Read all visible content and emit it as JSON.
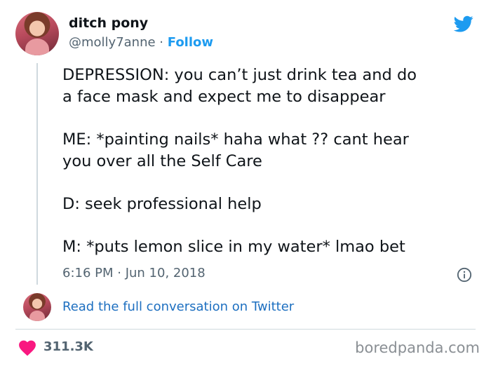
{
  "tweet": {
    "display_name": "ditch pony",
    "handle": "@molly7anne",
    "separator": " · ",
    "follow_label": "Follow",
    "lines": [
      "DEPRESSION: you can’t just drink tea and do",
      "a face mask and expect me to disappear",
      "",
      "ME: *painting nails* haha what ?? cant hear",
      "you over all the Self Care",
      "",
      "D: seek professional help",
      "",
      "M: *puts lemon slice in my water* lmao bet"
    ],
    "time": "6:16 PM",
    "date_separator": " · ",
    "date": "Jun 10, 2018"
  },
  "thread": {
    "read_link": "Read the full conversation on Twitter"
  },
  "footer": {
    "likes": "311.3K",
    "watermark": "boredpanda.com"
  },
  "colors": {
    "brand_blue": "#1d9bf0",
    "link_blue": "#1d6fc0",
    "heart": "#f91880",
    "secondary_text": "#536471",
    "divider": "#cfd9de"
  },
  "icons": [
    "twitter-bird-icon",
    "info-icon",
    "heart-icon"
  ]
}
